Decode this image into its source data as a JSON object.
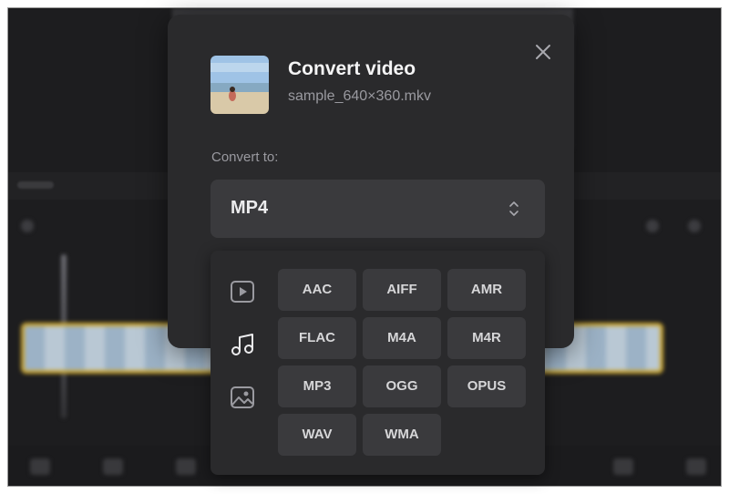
{
  "dialog": {
    "title": "Convert video",
    "filename": "sample_640×360.mkv",
    "convert_label": "Convert to:",
    "selected_format": "MP4"
  },
  "categories": [
    {
      "icon": "video-play-icon",
      "active": false
    },
    {
      "icon": "music-note-icon",
      "active": true
    },
    {
      "icon": "image-icon",
      "active": false
    }
  ],
  "formats": [
    "AAC",
    "AIFF",
    "AMR",
    "FLAC",
    "M4A",
    "M4R",
    "MP3",
    "OGG",
    "OPUS",
    "WAV",
    "WMA"
  ],
  "colors": {
    "dialog_bg": "#2a2a2c",
    "button_bg": "#3a3a3d",
    "text_primary": "#f4f4f5",
    "text_secondary": "#9a9aa0",
    "track_border": "#caa531"
  }
}
